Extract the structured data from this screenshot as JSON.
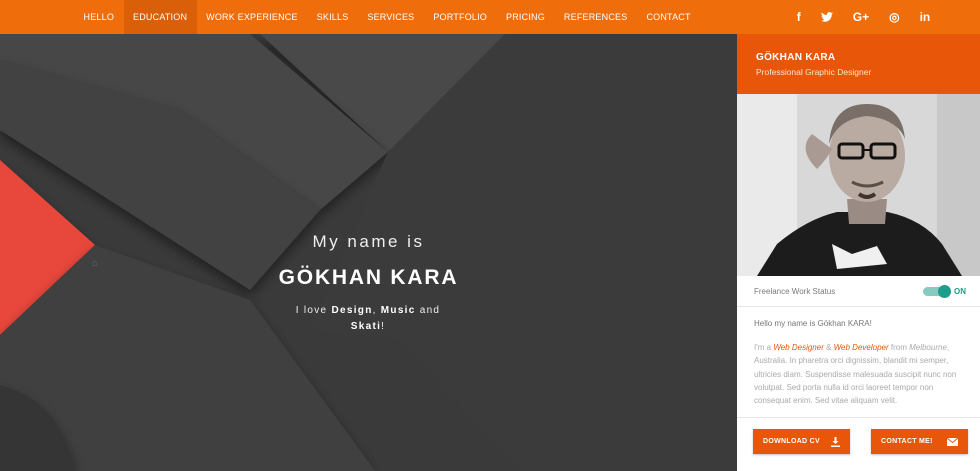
{
  "nav": {
    "items": [
      {
        "label": "HELLO"
      },
      {
        "label": "EDUCATION",
        "active": true
      },
      {
        "label": "WORK EXPERIENCE"
      },
      {
        "label": "SKILLS"
      },
      {
        "label": "SERVICES"
      },
      {
        "label": "PORTFOLIO"
      },
      {
        "label": "PRICING"
      },
      {
        "label": "REFERENCES"
      },
      {
        "label": "CONTACT"
      }
    ]
  },
  "intro": {
    "line1": "My name is",
    "name": "GÖKHAN KARA",
    "tag_prefix": "I love ",
    "tag_design": "Design",
    "tag_comma": ", ",
    "tag_music": "Music",
    "tag_and": " and ",
    "tag_skati": "Skati",
    "tag_suffix": "!"
  },
  "social": {
    "icons": [
      "facebook-icon",
      "twitter-icon",
      "google-plus-icon",
      "dribbble-icon",
      "linkedin-icon"
    ],
    "glyphs": [
      "f",
      "t",
      "G+",
      "◎",
      "in"
    ]
  },
  "profile": {
    "name": "GÖKHAN KARA",
    "title": "Professional Graphic Designer"
  },
  "status": {
    "label": "Freelance Work Status",
    "value": "ON"
  },
  "about": {
    "greeting": "Hello my name is Gökhan KARA!",
    "p1": "I'm a ",
    "role1": "Web Designer",
    "p2": " & ",
    "role2": "Web Developer",
    "p3": " from ",
    "city": "Melbourne",
    "p4": ", Australia. In pharetra orci dignissim, blandit mi semper, ultricies diam. Suspendisse malesuada suscipit nunc non volutpat. Sed porta nulla id orci laoreet tempor non consequat enim. Sed vitae aliquam velit."
  },
  "buttons": {
    "download_cv": "DOWNLOAD CV",
    "contact": "CONTACT ME!"
  },
  "colors": {
    "accent": "#f06d0c",
    "accent_dark": "#e8560a",
    "toggle": "#1e9d8b",
    "red_shape": "#e8473a"
  }
}
